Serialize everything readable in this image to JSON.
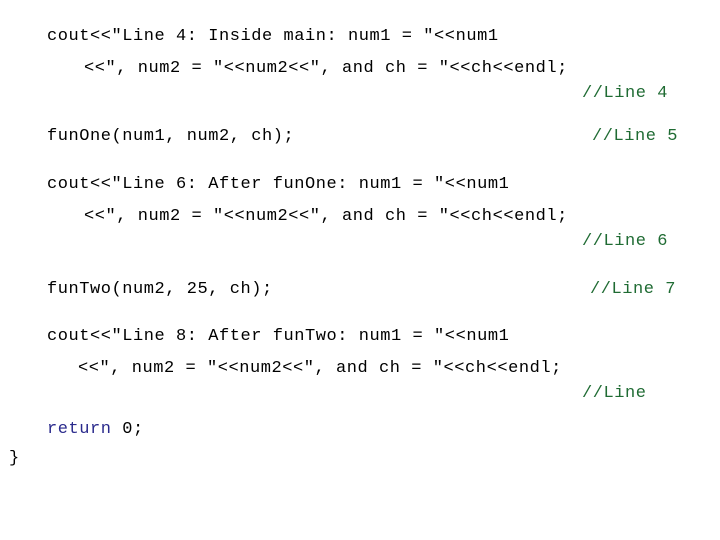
{
  "slide": {
    "title": "C++ source code slide",
    "background_color": "#ffffff",
    "text_color": "#000000",
    "keyword_color": "#2a2a8c",
    "comment_color": "#1f6b33",
    "language": "cpp"
  },
  "code": {
    "rows": [
      {
        "id": "row-1",
        "text": "cout<<\"Line 4: Inside main: num1 = \"<<num1"
      },
      {
        "id": "row-2",
        "text": "<<\", num2 = \"<<num2<<\", and ch = \"<<ch<<endl;"
      },
      {
        "id": "row-3",
        "text": "//Line 4"
      },
      {
        "id": "row-4",
        "text": "funOne(num1, num2, ch);"
      },
      {
        "id": "row-5",
        "text": "//Line 5"
      },
      {
        "id": "row-6",
        "text": "cout<<\"Line 6: After funOne: num1 = \"<<num1"
      },
      {
        "id": "row-7",
        "text": "<<\", num2 = \"<<num2<<\", and ch = \"<<ch<<endl;"
      },
      {
        "id": "row-8",
        "text": "//Line 6"
      },
      {
        "id": "row-9",
        "text": "funTwo(num2, 25, ch);"
      },
      {
        "id": "row-10",
        "text": "//Line 7"
      },
      {
        "id": "row-11",
        "text": "cout<<\"Line 8: After funTwo: num1 = \"<<num1"
      },
      {
        "id": "row-12",
        "text": "<<\", num2 = \"<<num2<<\", and ch = \"<<ch<<endl;"
      },
      {
        "id": "row-13",
        "text": "//Line"
      },
      {
        "id": "row-14-keyword",
        "text": "return"
      },
      {
        "id": "row-14-rest",
        "text": " 0;"
      },
      {
        "id": "row-15",
        "text": "}"
      }
    ]
  }
}
